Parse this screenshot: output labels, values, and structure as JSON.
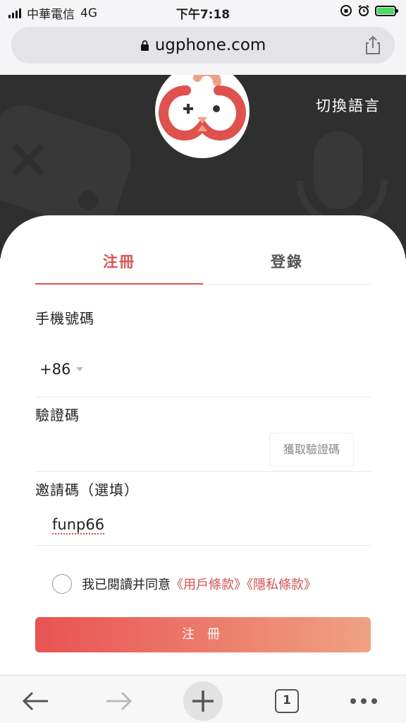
{
  "status": {
    "carrier": "中華電信",
    "network": "4G",
    "time": "下午7:18"
  },
  "browser": {
    "url": "ugphone.com",
    "tab_count": "1"
  },
  "header": {
    "language_switch": "切換語言"
  },
  "tabs": [
    {
      "label": "注冊",
      "active": true
    },
    {
      "label": "登錄",
      "active": false
    }
  ],
  "form": {
    "phone_label": "手機號碼",
    "country_code": "+86",
    "code_label": "驗證碼",
    "get_code": "獲取驗證碼",
    "invite_label": "邀請碼（選填）",
    "invite_value": "funp66",
    "agree_text": "我已閱讀并同意",
    "terms_link": "《用戶條款》",
    "privacy_link": "《隱私條款》",
    "submit": "注 冊"
  },
  "colors": {
    "accent": "#e0504d",
    "banner": "#2f2f2f"
  }
}
